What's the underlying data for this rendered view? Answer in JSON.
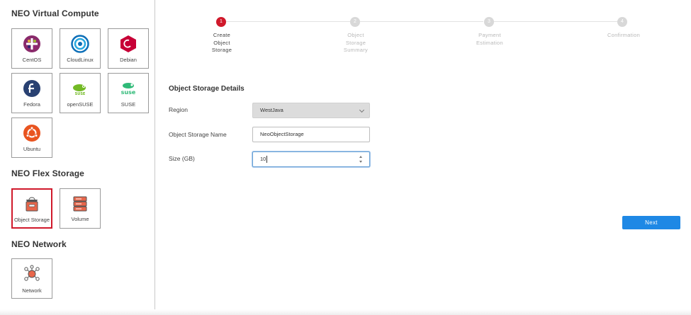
{
  "sidebar": {
    "sections": {
      "virtual_compute": "NEO Virtual Compute",
      "flex_storage": "NEO Flex Storage",
      "network": "NEO Network"
    },
    "tiles": {
      "centos": "CentOS",
      "cloudlinux": "CloudLinux",
      "debian": "Debian",
      "fedora": "Fedora",
      "opensuse": "openSUSE",
      "suse": "SUSE",
      "ubuntu": "Ubuntu",
      "object_storage": "Object Storage",
      "volume": "Volume",
      "network": "Network"
    },
    "selected_tile": "Object Storage"
  },
  "stepper": {
    "steps": [
      {
        "number": "1",
        "label": "Create Object Storage",
        "lines": [
          "Create",
          "Object",
          "Storage"
        ],
        "active": true
      },
      {
        "number": "2",
        "label": "Object Storage Summary",
        "lines": [
          "Object",
          "Storage",
          "Summary"
        ],
        "active": false
      },
      {
        "number": "3",
        "label": "Payment Estimation",
        "lines": [
          "Payment",
          "Estimation"
        ],
        "active": false
      },
      {
        "number": "4",
        "label": "Confirmation",
        "lines": [
          "Confirmation"
        ],
        "active": false
      }
    ]
  },
  "form": {
    "title": "Object Storage Details",
    "region_label": "Region",
    "region_value": "WestJava",
    "name_label": "Object Storage Name",
    "name_value": "NeoObjectStorage",
    "size_label": "Size (GB)",
    "size_value": "10"
  },
  "actions": {
    "next_label": "Next"
  },
  "colors": {
    "accent_red": "#d0192b",
    "primary_blue": "#1e88e5"
  }
}
